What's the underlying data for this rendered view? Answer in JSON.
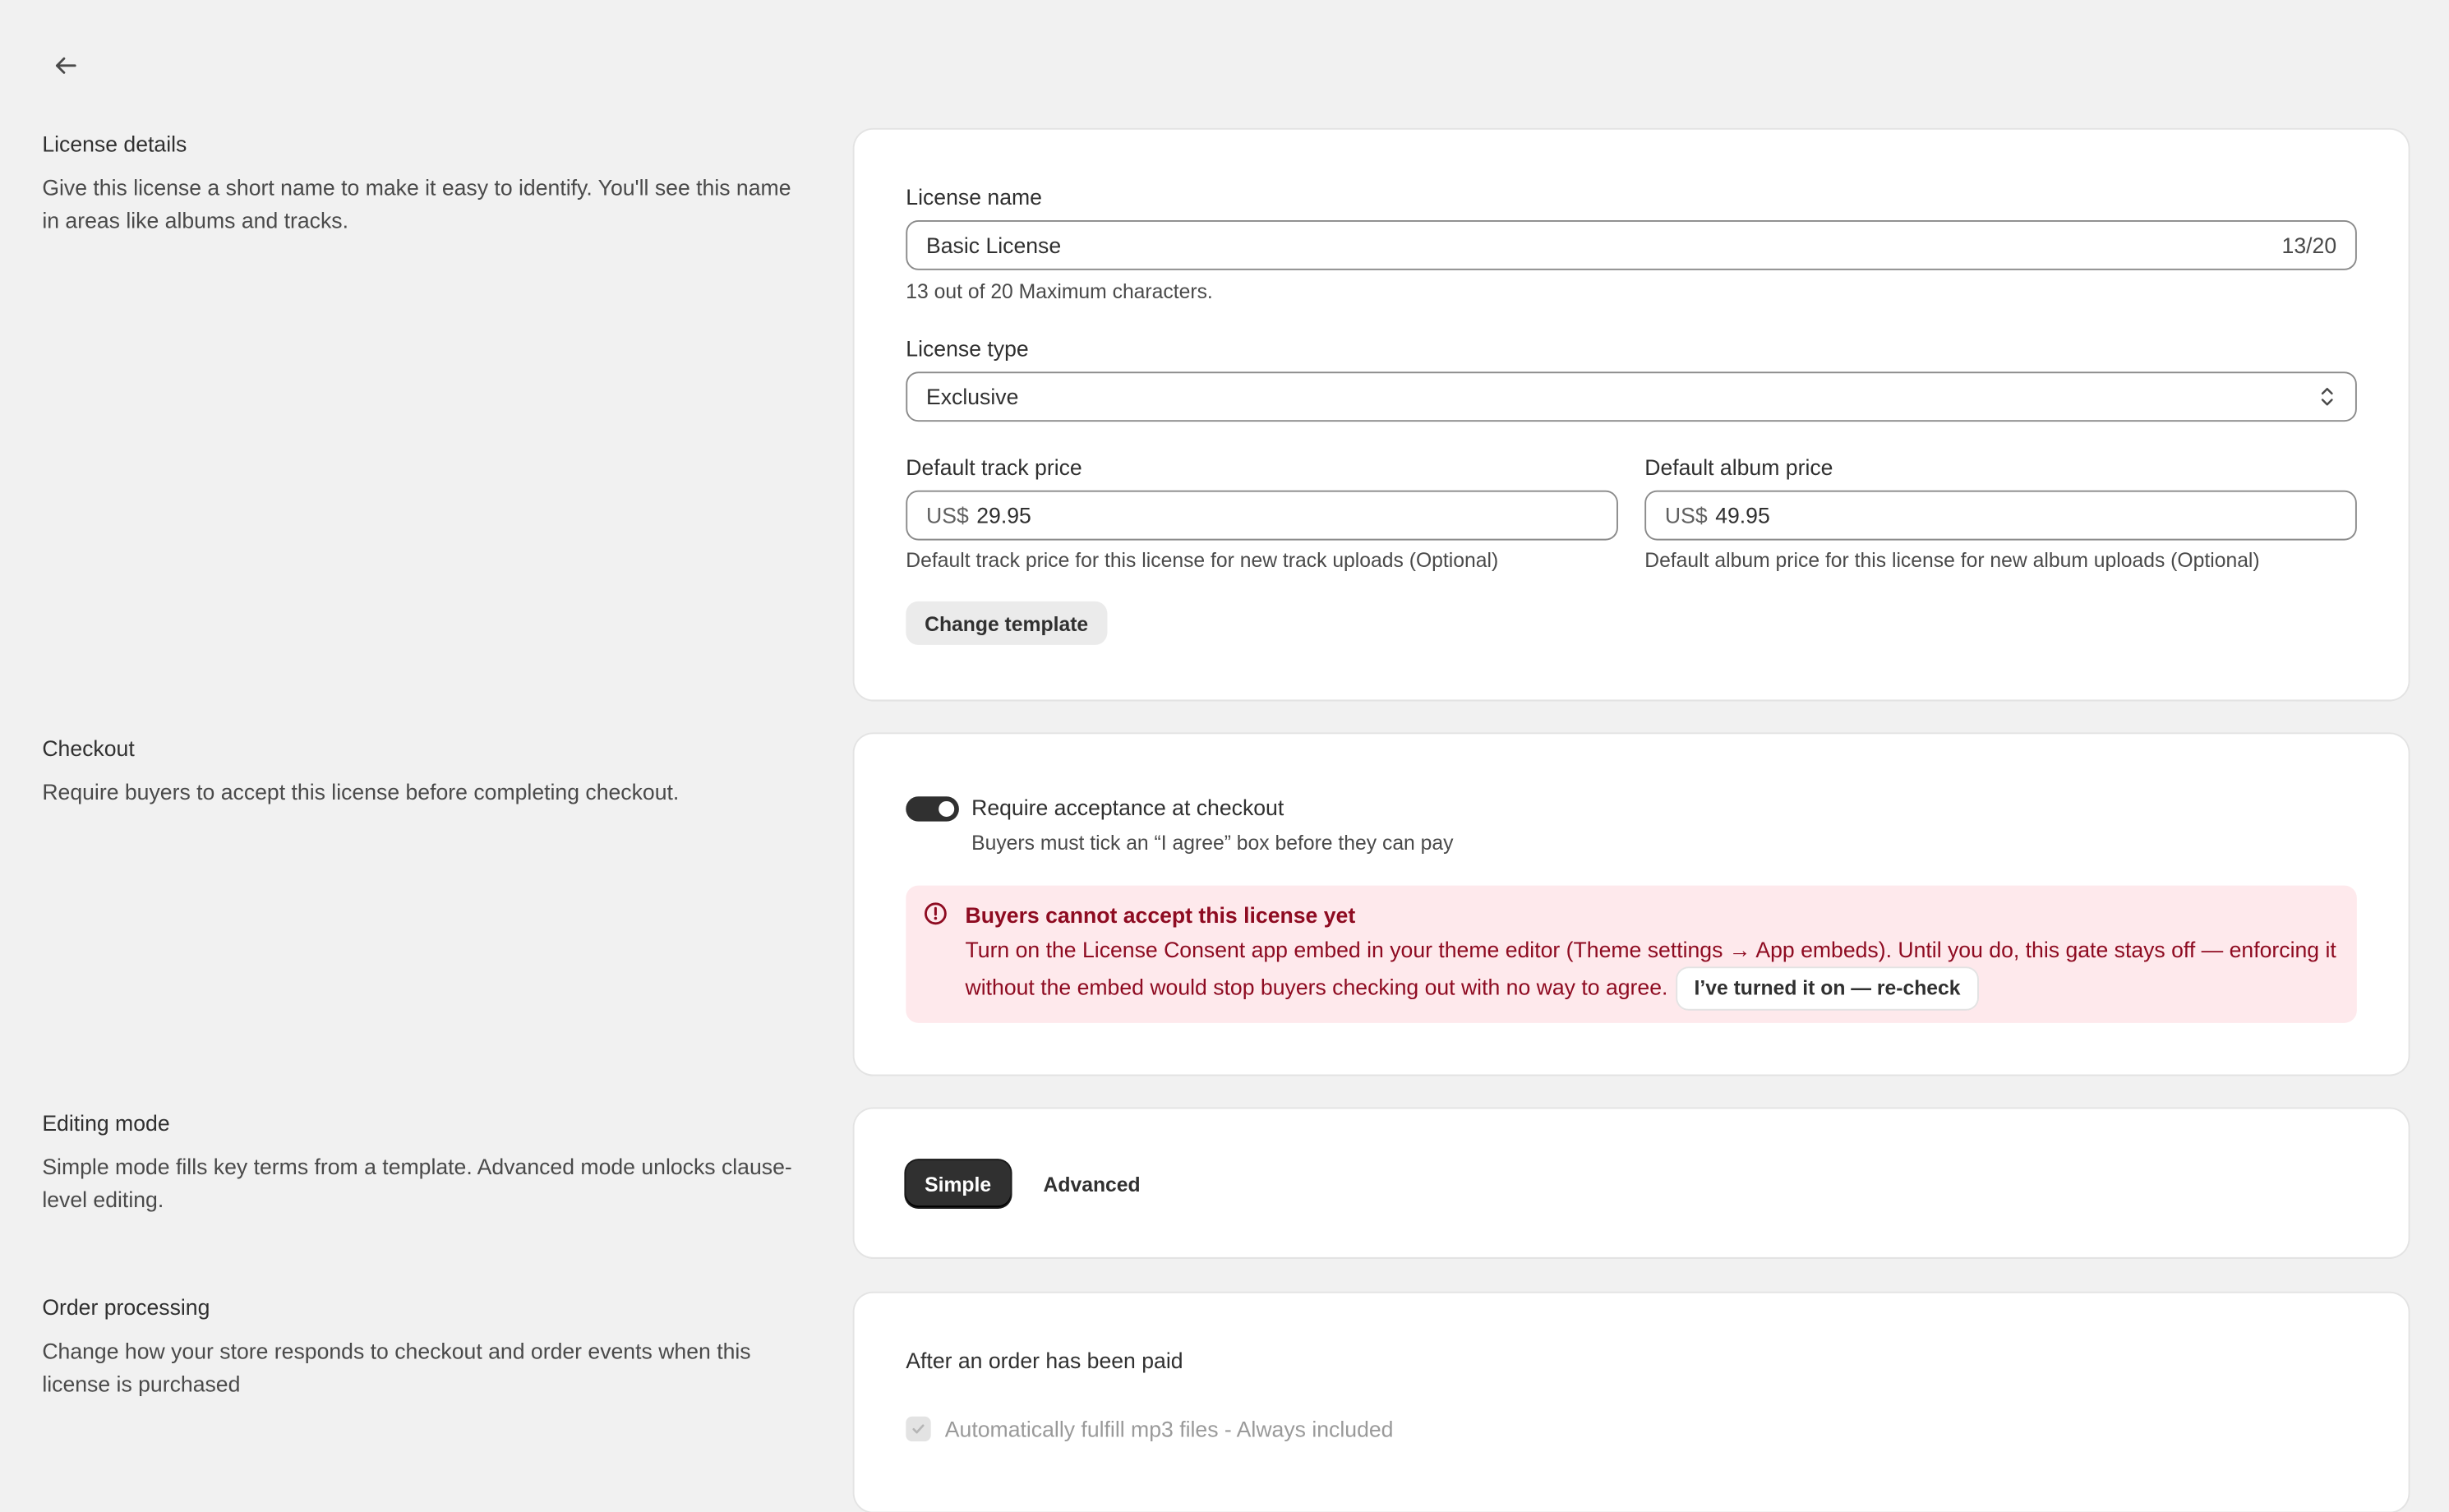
{
  "nav": {
    "back_icon": "arrow-left-icon"
  },
  "license_details": {
    "title": "License details",
    "description": "Give this license a short name to make it easy to identify. You'll see this name in areas like albums and tracks.",
    "name_label": "License name",
    "name_value": "Basic License",
    "name_counter": "13/20",
    "name_help": "13 out of 20 Maximum characters.",
    "type_label": "License type",
    "type_value": "Exclusive",
    "track_price_label": "Default track price",
    "track_price_prefix": "US$",
    "track_price_value": "29.95",
    "track_price_help": "Default track price for this license for new track uploads (Optional)",
    "album_price_label": "Default album price",
    "album_price_prefix": "US$",
    "album_price_value": "49.95",
    "album_price_help": "Default album price for this license for new album uploads (Optional)",
    "change_template_label": "Change template"
  },
  "checkout": {
    "title": "Checkout",
    "description": "Require buyers to accept this license before completing checkout.",
    "toggle_on": true,
    "toggle_label": "Require acceptance at checkout",
    "toggle_help": "Buyers must tick an “I agree” box before they can pay",
    "banner": {
      "icon": "alert-circle-icon",
      "title": "Buyers cannot accept this license yet",
      "body": "Turn on the License Consent app embed in your theme editor (Theme settings → App embeds). Until you do, this gate stays off — enforcing it without the embed would stop buyers checking out with no way to agree.",
      "recheck_label": "I’ve turned it on — re-check"
    }
  },
  "editing_mode": {
    "title": "Editing mode",
    "description": "Simple mode fills key terms from a template. Advanced mode unlocks clause-level editing.",
    "options": [
      {
        "label": "Simple"
      },
      {
        "label": "Advanced"
      }
    ],
    "selected": "Simple"
  },
  "order_processing": {
    "title": "Order processing",
    "description": "Change how your store responds to checkout and order events when this license is purchased",
    "heading": "After an order has been paid",
    "auto_fulfill_label": "Automatically fulfill mp3 files - Always included",
    "auto_fulfill_checked": true
  },
  "colors": {
    "critical_bg": "#fee9ec",
    "critical_text": "#8e0b21",
    "primary": "#303030",
    "surface": "#ffffff",
    "page_bg": "#f1f1f1"
  }
}
